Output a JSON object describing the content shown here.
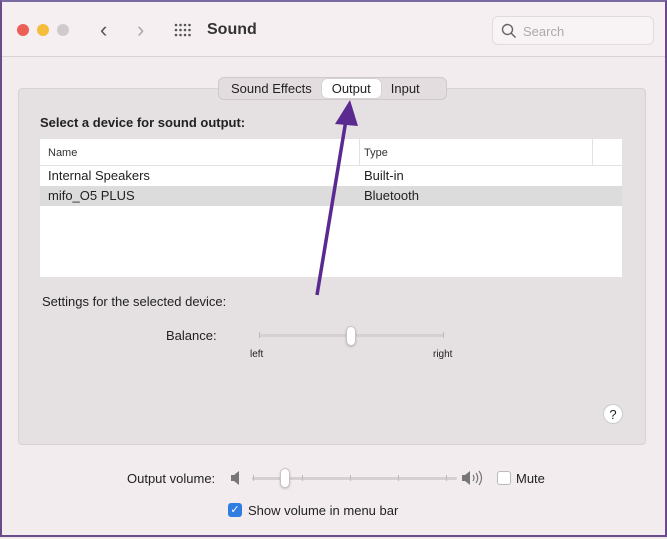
{
  "window": {
    "title": "Sound",
    "search_placeholder": "Search",
    "icons": [
      "close",
      "minimize",
      "zoom",
      "back",
      "forward",
      "grid",
      "search"
    ]
  },
  "tabs": [
    {
      "label": "Sound Effects"
    },
    {
      "label": "Output",
      "active": true
    },
    {
      "label": "Input"
    }
  ],
  "output": {
    "heading": "Select a device for sound output:",
    "columns": [
      "Name",
      "Type"
    ],
    "devices": [
      {
        "name": "Internal Speakers",
        "type": "Built-in",
        "selected": false
      },
      {
        "name": "mifo_O5 PLUS",
        "type": "Bluetooth",
        "selected": true
      }
    ],
    "settings_label": "Settings for the selected device:",
    "balance": {
      "label": "Balance:",
      "left": "left",
      "right": "right",
      "value": 0.5
    }
  },
  "help": "?",
  "volume": {
    "label": "Output volume:",
    "value": 0.17,
    "mute_label": "Mute",
    "mute_checked": false,
    "show_in_menu_bar_label": "Show volume in menu bar",
    "show_in_menu_bar_checked": true
  },
  "colors": {
    "accent": "#2f7de1",
    "arrow": "#5b2a91",
    "selected_row": "#dcdcdc"
  }
}
